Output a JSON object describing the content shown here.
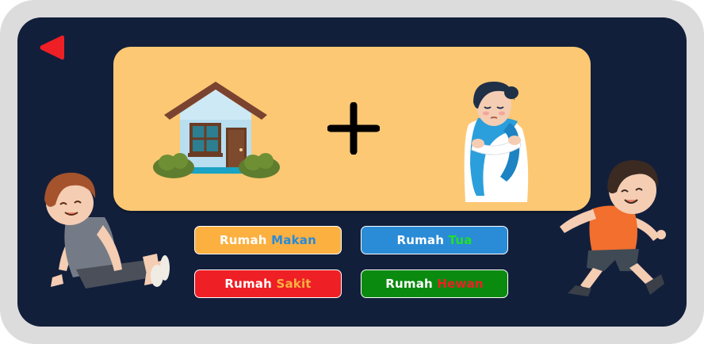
{
  "colors": {
    "frame": "#dcdcdc",
    "screen": "#121f3b",
    "card": "#fdc874",
    "back_button": "#ee2026"
  },
  "icons": {
    "back": "back-arrow-icon",
    "house": "house-icon",
    "plus": "plus-icon",
    "sick_person": "sick-person-icon",
    "boy_sitting": "boy-sitting-illustration",
    "boy_running": "boy-running-illustration"
  },
  "answers": [
    {
      "word1": "Rumah",
      "word2": "Makan",
      "bg": "#fbb040",
      "word2_color": "#2a8ad8"
    },
    {
      "word1": "Rumah",
      "word2": "Tua",
      "bg": "#2a8bd6",
      "word2_color": "#22e02a"
    },
    {
      "word1": "Rumah",
      "word2": "Sakit",
      "bg": "#ee1f25",
      "word2_color": "#fbb040"
    },
    {
      "word1": "Rumah",
      "word2": "Hewan",
      "bg": "#0b8a10",
      "word2_color": "#ee1f25"
    }
  ]
}
